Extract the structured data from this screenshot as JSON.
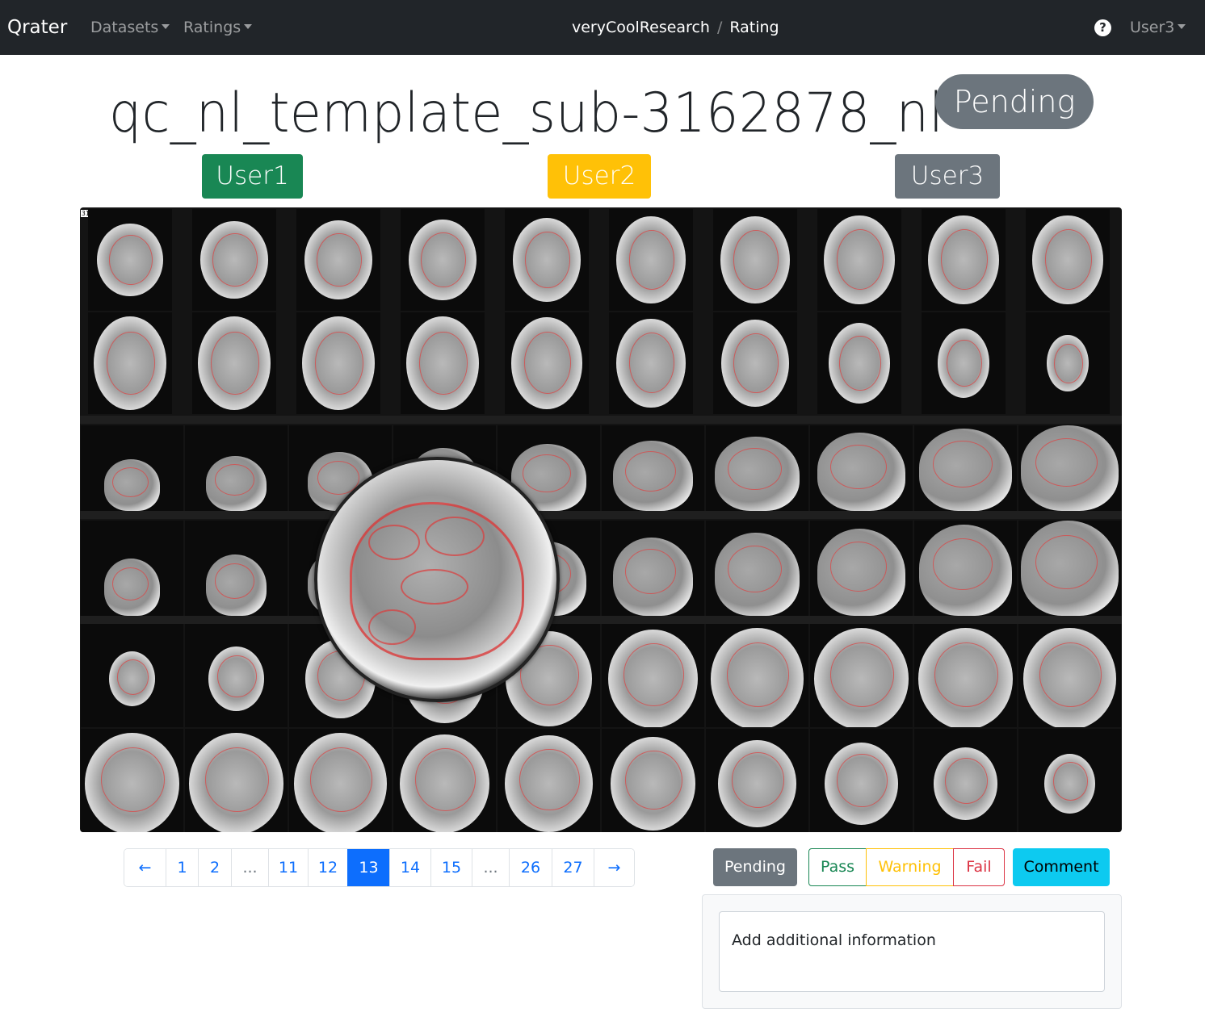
{
  "navbar": {
    "brand": "Qrater",
    "menus": [
      "Datasets",
      "Ratings"
    ],
    "breadcrumb": [
      "veryCoolResearch",
      "Rating"
    ],
    "breadcrumb_separator": "/",
    "help_label": "?",
    "user": "User3"
  },
  "image": {
    "title": "qc_nl_template_sub-3162878_nl",
    "status": "Pending",
    "subject_tag": "3162878"
  },
  "raters": [
    {
      "name": "User1",
      "color": "#198754"
    },
    {
      "name": "User2",
      "color": "#ffc107"
    },
    {
      "name": "User3",
      "color": "#6c757d"
    }
  ],
  "pagination": {
    "prev": "←",
    "next": "→",
    "pages": [
      "1",
      "2",
      "...",
      "11",
      "12",
      "13",
      "14",
      "15",
      "...",
      "26",
      "27"
    ],
    "active": "13"
  },
  "rating_buttons": {
    "pending": "Pending",
    "pass": "Pass",
    "warning": "Warning",
    "fail": "Fail",
    "comment": "Comment"
  },
  "comment": {
    "placeholder": "Add additional information"
  },
  "colors": {
    "navbar": "#212529",
    "primary": "#0d6efd",
    "success": "#198754",
    "warning": "#ffc107",
    "danger": "#dc3545",
    "info": "#0dcaf0",
    "secondary": "#6c757d"
  }
}
